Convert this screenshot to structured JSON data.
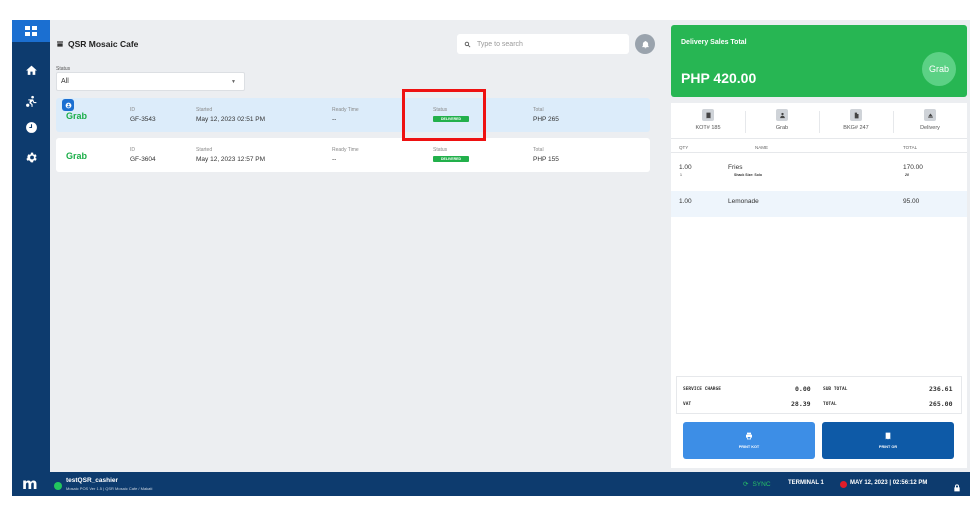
{
  "store": {
    "name": "QSR Mosaic Cafe"
  },
  "search": {
    "placeholder": "Type to search"
  },
  "filter": {
    "label": "Status",
    "value": "All"
  },
  "orders": [
    {
      "brand": "Grab",
      "id_label": "ID",
      "id": "GF-3543",
      "started_label": "Started",
      "started": "May 12, 2023 02:51 PM",
      "ready_label": "Ready Time",
      "ready": "--",
      "status_label": "Status",
      "status": "DELIVERED",
      "total_label": "Total",
      "total": "PHP 265"
    },
    {
      "brand": "Grab",
      "id_label": "ID",
      "id": "GF-3604",
      "started_label": "Started",
      "started": "May 12, 2023 12:57 PM",
      "ready_label": "Ready Time",
      "ready": "--",
      "status_label": "Status",
      "status": "DELIVERED",
      "total_label": "Total",
      "total": "PHP 155"
    }
  ],
  "summary": {
    "title": "Delivery Sales Total",
    "amount": "PHP 420.00",
    "logo": "Grab"
  },
  "tabs": [
    {
      "label": "KOT# 185",
      "icon": "receipt-icon"
    },
    {
      "label": "Grab",
      "icon": "person-icon"
    },
    {
      "label": "BKG# 247",
      "icon": "document-icon"
    },
    {
      "label": "Delivery",
      "icon": "eject-icon"
    }
  ],
  "table_headers": {
    "qty": "QTY",
    "name": "NAME",
    "total": "TOTAL"
  },
  "items": [
    {
      "qty": "1.00",
      "name": "Fries",
      "sub_qty": "1",
      "sub_name": "Shack Size: Solo",
      "total": "170.00",
      "sub_total": "20"
    },
    {
      "qty": "1.00",
      "name": "Lemonade",
      "total": "95.00"
    }
  ],
  "totals": {
    "service_charge_label": "SERVICE CHARGE",
    "service_charge": "0.00",
    "vat_label": "VAT",
    "vat": "28.39",
    "subtotal_label": "SUB TOTAL",
    "subtotal": "236.61",
    "total_label": "TOTAL",
    "total": "265.00"
  },
  "buttons": {
    "print_kot": "PRINT KOT",
    "print_or": "PRINT OR"
  },
  "footer": {
    "logo": "m",
    "user": "testQSR_cashier",
    "version": "Mosaic POS Ver 1.5 | QSR Mosaic Cafe / Makati",
    "sync": "SYNC",
    "terminal": "TERMINAL 1",
    "datetime": "MAY 12, 2023 | 02:56:12 PM"
  },
  "colors": {
    "sidebar": "#0d3b6e",
    "accent": "#1b6fd1",
    "grab_green": "#27b653",
    "highlight": "#e11111"
  }
}
